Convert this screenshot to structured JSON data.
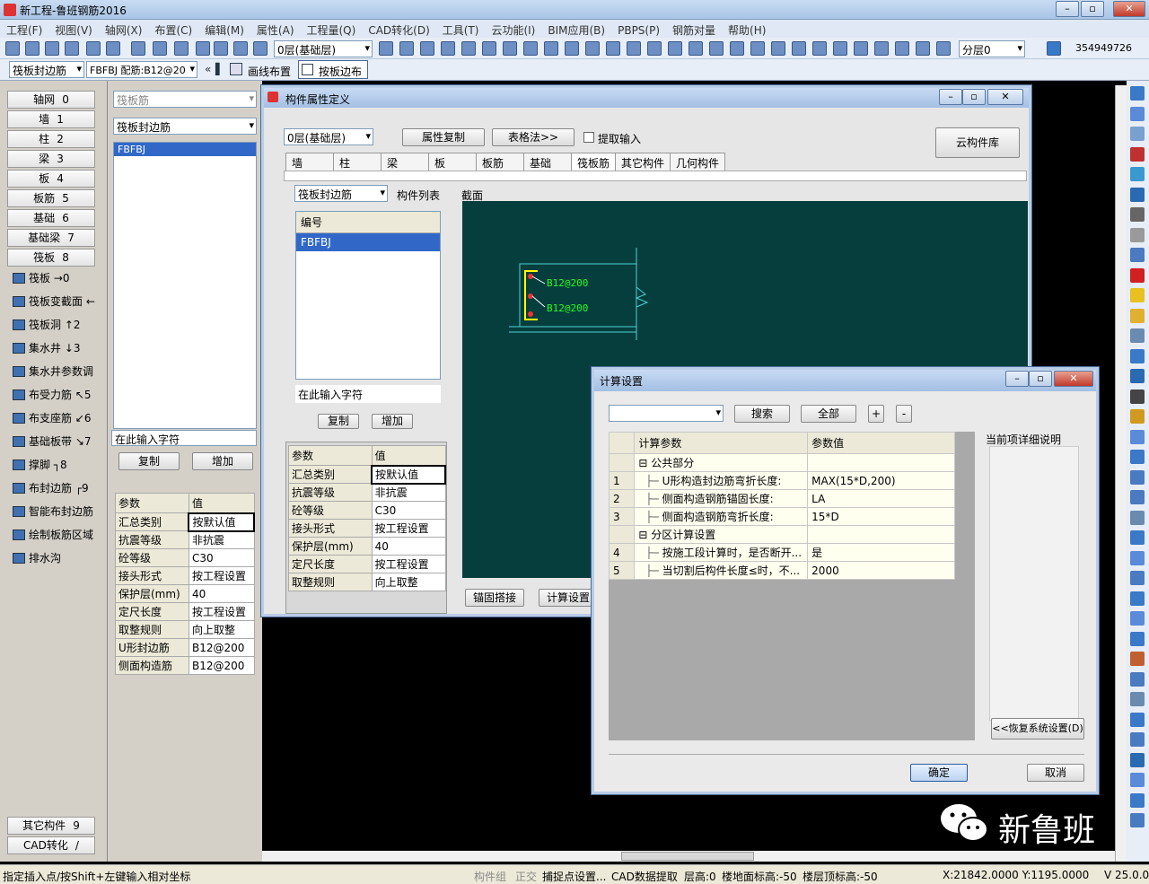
{
  "app": {
    "title": "新工程-鲁班钢筋2016"
  },
  "menu": [
    "工程(F)",
    "视图(V)",
    "轴网(X)",
    "布置(C)",
    "编辑(M)",
    "属性(A)",
    "工程量(Q)",
    "CAD转化(D)",
    "工具(T)",
    "云功能(I)",
    "BIM应用(B)",
    "PBPS(P)",
    "钢筋对量",
    "帮助(H)"
  ],
  "toolbar": {
    "layer": "0层(基础层)",
    "sublayer": "分层0",
    "counter": "354949726"
  },
  "toolbar2": {
    "component_type": "筏板封边筋",
    "component_name": "FBFBJ 配筋:B12@20",
    "line_layout": "画线布置",
    "edge_layout": "按板边布"
  },
  "left": {
    "categories": [
      {
        "label": "轴网",
        "key": "0"
      },
      {
        "label": "墙",
        "key": "1"
      },
      {
        "label": "柱",
        "key": "2"
      },
      {
        "label": "梁",
        "key": "3"
      },
      {
        "label": "板",
        "key": "4"
      },
      {
        "label": "板筋",
        "key": "5"
      },
      {
        "label": "基础",
        "key": "6"
      },
      {
        "label": "基础梁",
        "key": "7"
      },
      {
        "label": "筏板",
        "key": "8"
      }
    ],
    "subitems": [
      "筏板 →0",
      "筏板变截面 ←",
      "筏板洞 ↑2",
      "集水井 ↓3",
      "集水井参数调",
      "布受力筋 ↖5",
      "布支座筋 ↙6",
      "基础板带 ↘7",
      "撑脚 ┐8",
      "布封边筋 ┌9",
      "智能布封边筋",
      "绘制板筋区域",
      "排水沟"
    ],
    "bottom": [
      {
        "label": "其它构件",
        "key": "9"
      },
      {
        "label": "CAD转化",
        "key": "/"
      }
    ]
  },
  "mid": {
    "type_placeholder": "筏板筋",
    "type_select": "筏板封边筋",
    "selected": "FBFBJ",
    "input_placeholder": "在此输入字符",
    "copy": "复制",
    "add": "增加",
    "props": {
      "header": [
        "参数",
        "值"
      ],
      "rows": [
        [
          "汇总类别",
          "按默认值"
        ],
        [
          "抗震等级",
          "非抗震"
        ],
        [
          "砼等级",
          "C30"
        ],
        [
          "接头形式",
          "按工程设置"
        ],
        [
          "保护层(mm)",
          "40"
        ],
        [
          "定尺长度",
          "按工程设置"
        ],
        [
          "取整规则",
          "向上取整"
        ],
        [
          "U形封边筋",
          "B12@200"
        ],
        [
          "侧面构造筋",
          "B12@200"
        ]
      ]
    }
  },
  "dlg1": {
    "title": "构件属性定义",
    "layer": "0层(基础层)",
    "copy_prop": "属性复制",
    "table_method": "表格法>>",
    "extract_input": "提取输入",
    "cloud_lib": "云构件库",
    "tabs": [
      "墙",
      "柱",
      "梁",
      "板",
      "板筋",
      "基础",
      "筏板筋",
      "其它构件",
      "几何构件"
    ],
    "type_select": "筏板封边筋",
    "list_label": "构件列表",
    "section_label": "截面",
    "list_header": "编号",
    "selected": "FBFBJ",
    "input_placeholder": "在此输入字符",
    "copy": "复制",
    "add": "增加",
    "props": {
      "header": [
        "参数",
        "值"
      ],
      "rows": [
        [
          "汇总类别",
          "按默认值"
        ],
        [
          "抗震等级",
          "非抗震"
        ],
        [
          "砼等级",
          "C30"
        ],
        [
          "接头形式",
          "按工程设置"
        ],
        [
          "保护层(mm)",
          "40"
        ],
        [
          "定尺长度",
          "按工程设置"
        ],
        [
          "取整规则",
          "向上取整"
        ]
      ]
    },
    "rebar_top": "B12@200",
    "rebar_bottom": "B12@200",
    "anchor_btn": "锚固搭接",
    "calc_btn": "计算设置"
  },
  "dlg2": {
    "title": "计算设置",
    "search": "搜索",
    "all": "全部",
    "plus": "+",
    "minus": "-",
    "detail_label": "当前项详细说明",
    "restore": "<<恢复系统设置(D)",
    "ok": "确定",
    "cancel": "取消",
    "header": [
      "计算参数",
      "参数值"
    ],
    "rows": [
      {
        "n": "",
        "group": true,
        "label": "公共部分",
        "value": ""
      },
      {
        "n": "1",
        "label": "U形构造封边筋弯折长度:",
        "value": "MAX(15*D,200)"
      },
      {
        "n": "2",
        "label": "侧面构造钢筋锚固长度:",
        "value": "LA"
      },
      {
        "n": "3",
        "label": "侧面构造钢筋弯折长度:",
        "value": "15*D"
      },
      {
        "n": "",
        "group": true,
        "label": "分区计算设置",
        "value": ""
      },
      {
        "n": "4",
        "label": "按施工段计算时，是否断开...",
        "value": "是"
      },
      {
        "n": "5",
        "label": "当切割后构件长度≤时，不...",
        "value": "2000"
      }
    ]
  },
  "watermark": "新鲁班",
  "status": {
    "hint": "指定插入点/按Shift+左键输入相对坐标",
    "group": "构件组",
    "ortho": "正交",
    "snap": "捕捉点设置...",
    "cad": "CAD数据提取",
    "floor_h": "层高:0",
    "floor_bottom": "楼地面标高:-50",
    "floor_top": "楼层顶标高:-50",
    "coords": "X:21842.0000 Y:1195.0000",
    "version": "V 25.0.0"
  }
}
